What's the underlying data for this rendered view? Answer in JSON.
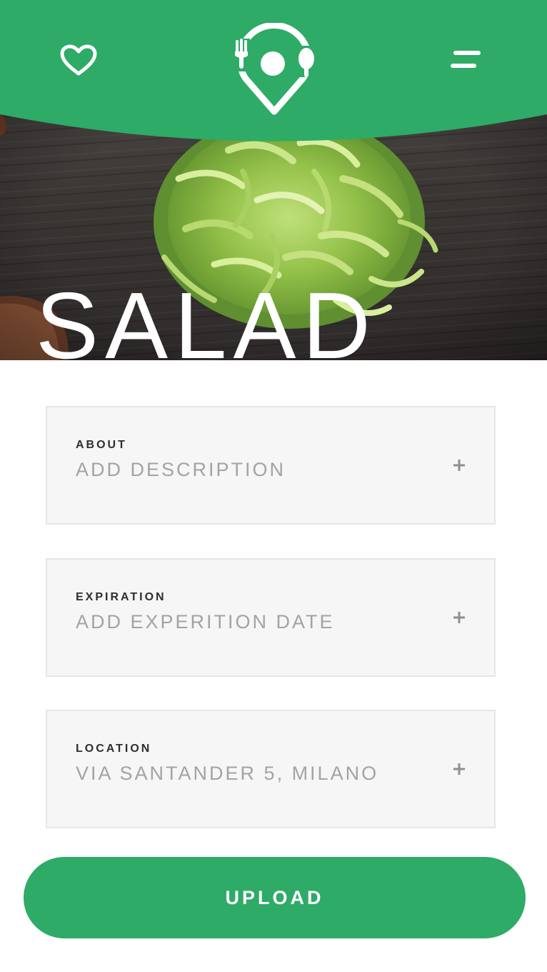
{
  "header": {
    "favorite_icon": "heart-outline-icon",
    "logo_icon": "map-pin-fork-spoon-logo",
    "menu_icon": "hamburger-menu-icon"
  },
  "hero": {
    "title": "SALAD",
    "image": "shredded-lettuce-on-wooden-table"
  },
  "fields": {
    "about": {
      "label": "ABOUT",
      "value": "ADD DESCRIPTION",
      "action_icon": "plus-icon"
    },
    "expiration": {
      "label": "EXPIRATION",
      "value": "ADD EXPERITION DATE",
      "action_icon": "plus-icon"
    },
    "location": {
      "label": "LOCATION",
      "value": "VIA SANTANDER 5, MILANO",
      "action_icon": "plus-icon"
    }
  },
  "actions": {
    "upload_label": "UPLOAD"
  },
  "colors": {
    "brand_green": "#2eab66",
    "field_background": "#f6f6f6",
    "label_text": "#2e2e2e",
    "placeholder_text": "#a3a3a3"
  }
}
